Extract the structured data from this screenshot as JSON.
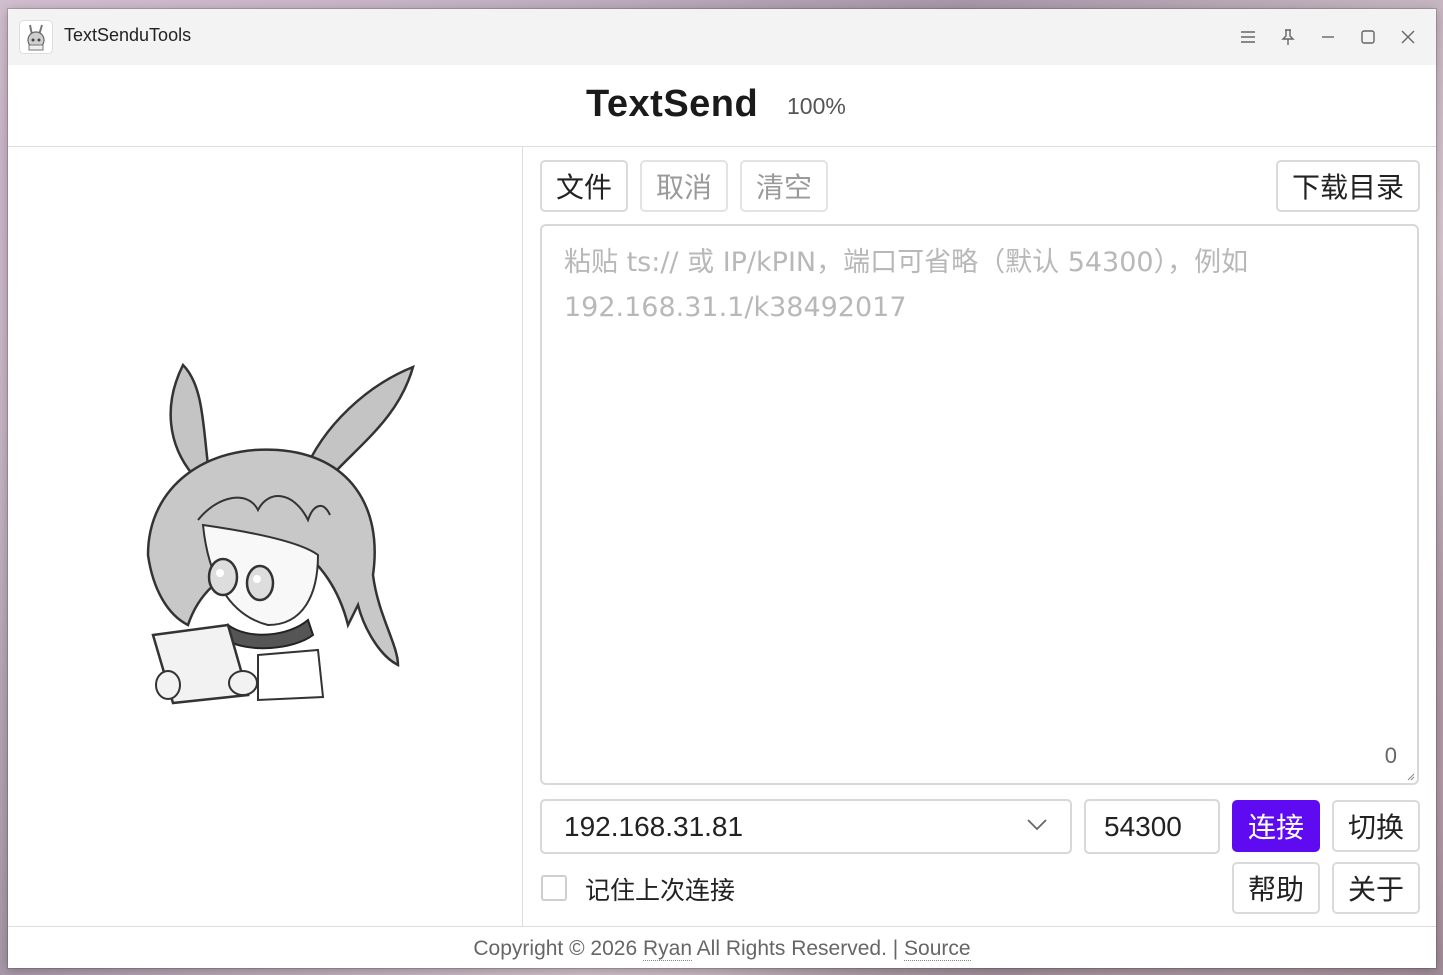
{
  "window": {
    "title": "TextSenduTools",
    "controls": [
      "menu-icon",
      "pin-icon",
      "minimize-icon",
      "maximize-icon",
      "close-icon"
    ]
  },
  "header": {
    "brand": "TextSend",
    "zoom": "100%"
  },
  "toolbar": {
    "file_label": "文件",
    "cancel_label": "取消",
    "clear_label": "清空",
    "download_dir_label": "下载目录"
  },
  "editor": {
    "placeholder_line1": "粘贴 ts:// 或 IP/kPIN，端口可省略（默认 54300），例如",
    "placeholder_line2": "192.168.31.1/k38492017",
    "char_count": "0"
  },
  "connection": {
    "host": "192.168.31.81",
    "port": "54300",
    "connect_label": "连接",
    "switch_label": "切换",
    "remember_label": "记住上次连接",
    "remember_checked": false,
    "help_label": "帮助",
    "about_label": "关于"
  },
  "footer": {
    "copyright": "Copyright © 2026 ",
    "author": "Ryan",
    "rights": " All Rights Reserved. | ",
    "source_label": "Source"
  },
  "colors": {
    "accent": "#5f0bf2",
    "border": "#d8d8d8",
    "titlebar": "#f3f3f3"
  }
}
